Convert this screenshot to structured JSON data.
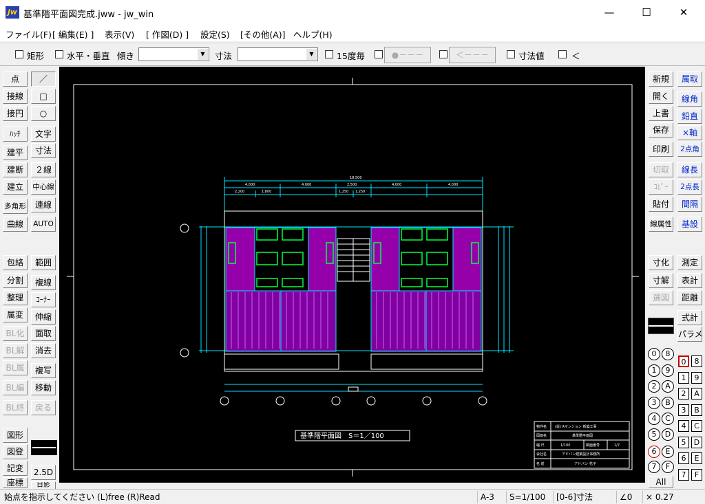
{
  "window": {
    "app_icon": "jw",
    "title": "基準階平面図完成.jww - jw_win",
    "minimize": "—",
    "maximize": "☐",
    "close": "✕"
  },
  "menu": [
    "ファイル(F)",
    "[ 編集(E) ]",
    "表示(V)",
    "[ 作図(D) ]",
    "設定(S)",
    "[その他(A)]",
    "ヘルプ(H)"
  ],
  "toolbar": {
    "rect_label": "矩形",
    "hv_label": "水平・垂直",
    "tilt_label": "傾き",
    "tilt_value": "",
    "dim_label": "寸法",
    "dim_value": "",
    "deg15_label": "15度毎",
    "btn_dot": "●－－－",
    "btn_arrow": "＜－－－",
    "dimval_label": "寸法値",
    "lt_label": "＜"
  },
  "left_tools": {
    "col1": [
      "点",
      "接線",
      "接円",
      "ﾊｯﾁ",
      "建平",
      "建断",
      "建立",
      "多角形",
      "曲線"
    ],
    "col2": [
      "／",
      "□",
      "○",
      "文字",
      "寸法",
      "２線",
      "中心線",
      "連線",
      "AUTO"
    ],
    "col3": [
      "包絡",
      "分割",
      "整理",
      "属変",
      "BL化",
      "BL解",
      "BL属",
      "BL編",
      "BL終"
    ],
    "col4": [
      "範囲",
      "複線",
      "ｺｰﾅｰ",
      "伸縮",
      "面取",
      "消去",
      "複写",
      "移動",
      "戻る"
    ],
    "col5": [
      "図形",
      "図登",
      "記変",
      "座標"
    ],
    "col6": [
      "2.5D",
      "日影"
    ]
  },
  "right_tools": {
    "colA": [
      "新規",
      "開く",
      "上書",
      "保存",
      "印刷",
      "切取",
      "ｺﾋﾟｰ",
      "貼付",
      "線属性"
    ],
    "colB": [
      "属取",
      "線角",
      "鉛直",
      "×軸",
      "2点角",
      "線長",
      "2点長",
      "間隔",
      "基設"
    ],
    "colC": [
      "寸化",
      "寸解",
      "選図"
    ],
    "colD": [
      "測定",
      "表計",
      "距離",
      "式計",
      "パラメ"
    ]
  },
  "layer_groups": [
    "0",
    "1",
    "2",
    "3",
    "4",
    "5",
    "6",
    "7"
  ],
  "layer_groups_right": [
    "8",
    "9",
    "A",
    "B",
    "C",
    "D",
    "E",
    "F"
  ],
  "layer_all": "All",
  "layers_left": [
    "0",
    "1",
    "2",
    "3",
    "4",
    "5",
    "6",
    "7"
  ],
  "layers_right": [
    "8",
    "9",
    "A",
    "B",
    "C",
    "D",
    "E",
    "F"
  ],
  "drawing": {
    "total_dim": "18,500",
    "dims_top": [
      "4,000",
      "4,000",
      "2,500",
      "4,000",
      "4,000"
    ],
    "dims_sub": [
      "2,200",
      "1,800",
      "1,250",
      "1,250"
    ],
    "caption": "基準階平面図　S＝1／100",
    "title_block": [
      [
        "物件名",
        "(仮) Aマンション 新築工事"
      ],
      [
        "図面名",
        "基準階平面図"
      ],
      [
        "縮 尺",
        "1/100",
        "図面番号",
        "1/7"
      ],
      [
        "会社名",
        "アドバン建築設計事務所"
      ],
      [
        "名 前",
        "アドバン 花子"
      ]
    ]
  },
  "status": {
    "message": "始点を指示してください (L)free (R)Read",
    "paper": "A-3",
    "scale": "S=1/100",
    "layer": "[0-6]寸法",
    "angle": "∠0",
    "zoom": "× 0.27"
  },
  "colors": {
    "canvas": "#000000",
    "wall_cyan": "#00e5ff",
    "room_magenta": "#b000c8",
    "fixture_green": "#00ff40",
    "frame_white": "#ffffff"
  }
}
